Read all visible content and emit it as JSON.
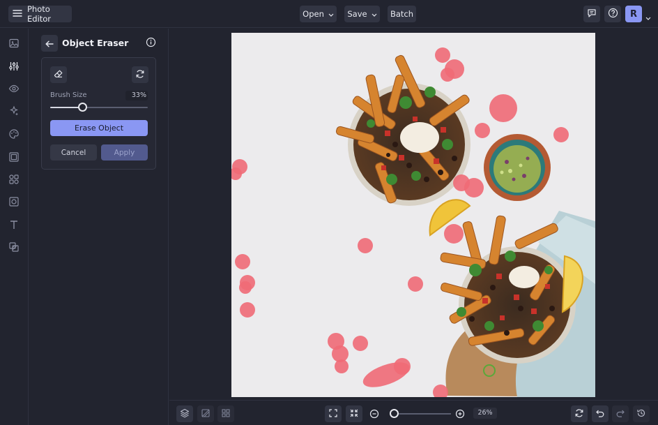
{
  "topbar": {
    "app_title": "Photo Editor",
    "open_label": "Open",
    "save_label": "Save",
    "batch_label": "Batch",
    "avatar_initial": "R",
    "icons": [
      "menu-icon",
      "chevron-down-icon",
      "feedback-icon",
      "help-icon"
    ]
  },
  "rail": {
    "icons": [
      "image-icon",
      "adjust-icon",
      "eye-icon",
      "effects-icon",
      "palette-icon",
      "frame-icon",
      "shapes-icon",
      "border-icon",
      "text-icon",
      "texture-icon"
    ]
  },
  "panel": {
    "title": "Object Eraser",
    "brush_size_label": "Brush Size",
    "brush_size_value": "33%",
    "brush_size_fraction": 0.33,
    "erase_label": "Erase Object",
    "cancel_label": "Cancel",
    "apply_label": "Apply"
  },
  "bottombar": {
    "zoom_value": "26%",
    "zoom_fraction": 0.05,
    "icons": [
      "layers-icon",
      "crop-icon",
      "grid-icon",
      "fit-screen-icon",
      "actual-size-icon",
      "zoom-out-icon",
      "zoom-in-icon",
      "rotate-icon",
      "undo-icon",
      "redo-icon",
      "history-icon"
    ]
  },
  "colors": {
    "accent": "#8a97f3",
    "apply_disabled": "#525a8e",
    "background": "#22242f",
    "brush_mark": "#f06a76"
  }
}
